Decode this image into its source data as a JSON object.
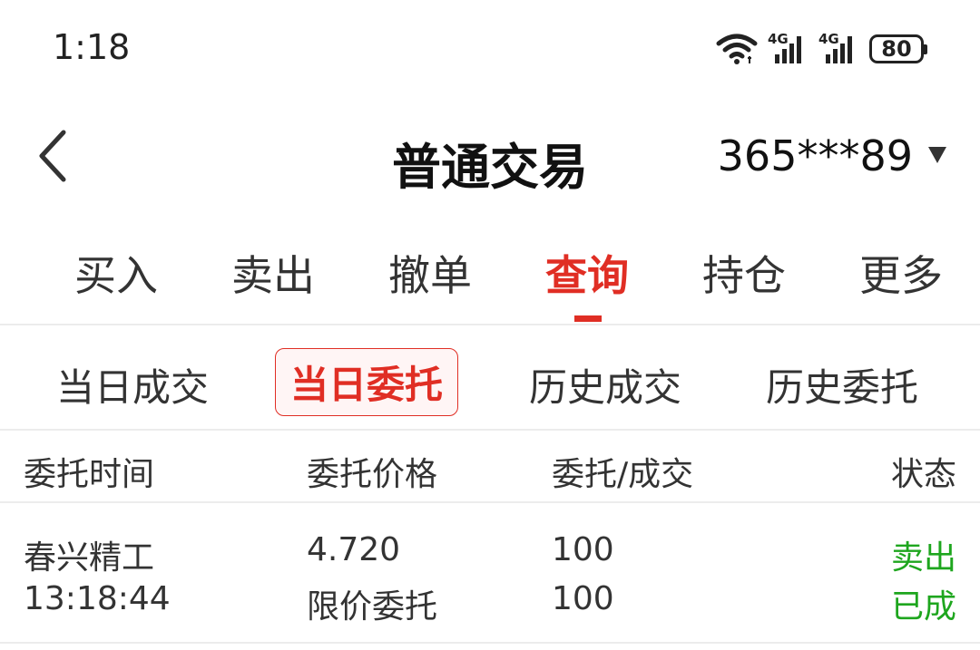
{
  "status_bar": {
    "time": "1:18",
    "network_1": "4G",
    "network_2": "4G",
    "battery": "80"
  },
  "header": {
    "title": "普通交易",
    "account": "365***89"
  },
  "main_tabs": [
    {
      "label": "买入"
    },
    {
      "label": "卖出"
    },
    {
      "label": "撤单"
    },
    {
      "label": "查询"
    },
    {
      "label": "持仓"
    },
    {
      "label": "更多"
    }
  ],
  "active_main_tab": "查询",
  "sub_tabs": [
    {
      "label": "当日成交"
    },
    {
      "label": "当日委托"
    },
    {
      "label": "历史成交"
    },
    {
      "label": "历史委托"
    }
  ],
  "active_sub_tab": "当日委托",
  "table": {
    "columns": [
      "委托时间",
      "委托价格",
      "委托/成交",
      "状态"
    ],
    "rows": [
      {
        "name": "春兴精工",
        "time": "13:18:44",
        "price": "4.720",
        "order_type": "限价委托",
        "order_qty": "100",
        "deal_qty": "100",
        "side": "卖出",
        "status": "已成"
      }
    ]
  },
  "colors": {
    "accent": "#e02e24",
    "success": "#1ea61e"
  }
}
